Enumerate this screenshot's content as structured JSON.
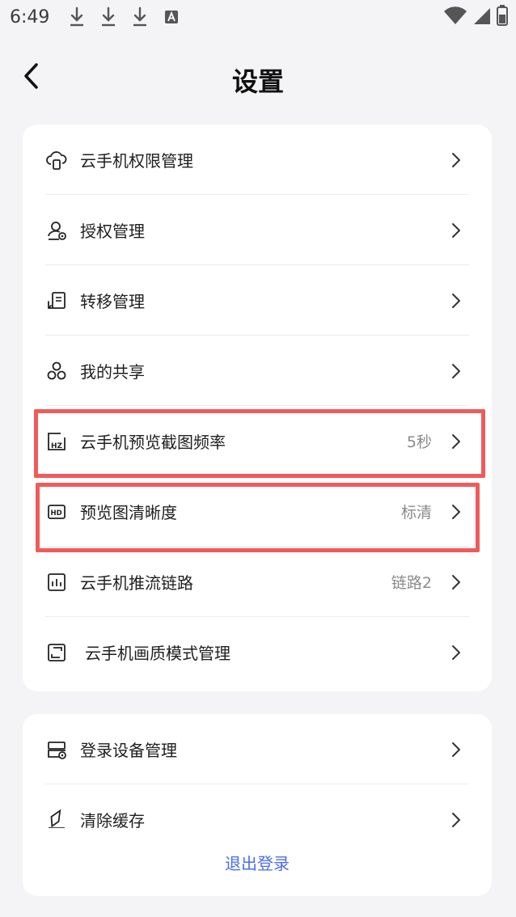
{
  "status_bar": {
    "time": "6:49",
    "icons": [
      "download-icon",
      "download-icon",
      "download-icon",
      "a-icon"
    ],
    "right_icons": [
      "wifi-icon",
      "signal-icon",
      "battery-icon"
    ]
  },
  "header": {
    "title": "设置",
    "back_icon": "chevron-left-icon"
  },
  "section_main": {
    "items": [
      {
        "label": "云手机权限管理",
        "icon": "cloud-phone-icon",
        "value": ""
      },
      {
        "label": "授权管理",
        "icon": "user-authorize-icon",
        "value": ""
      },
      {
        "label": "转移管理",
        "icon": "transfer-icon",
        "value": ""
      },
      {
        "label": "我的共享",
        "icon": "share-icon",
        "value": ""
      },
      {
        "label": "云手机预览截图频率",
        "icon": "hz-icon",
        "value": "5秒"
      },
      {
        "label": "预览图清晰度",
        "icon": "hd-icon",
        "value": "标清"
      },
      {
        "label": "云手机推流链路",
        "icon": "chart-icon",
        "value": "链路2"
      },
      {
        "label": "云手机画质模式管理",
        "icon": "quality-icon",
        "value": ""
      }
    ]
  },
  "section_account": {
    "items": [
      {
        "label": "登录设备管理",
        "icon": "device-icon",
        "value": ""
      },
      {
        "label": "清除缓存",
        "icon": "eraser-icon",
        "value": ""
      }
    ]
  },
  "logout": {
    "label": "退出登录"
  },
  "colors": {
    "highlight": "#ef5b5b",
    "accent": "#4a6cf0",
    "background": "#f4f4f6"
  }
}
